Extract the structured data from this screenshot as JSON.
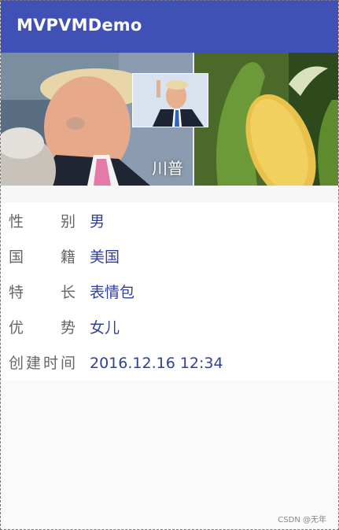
{
  "app": {
    "title": "MVPVMDemo"
  },
  "banner": {
    "name": "川普"
  },
  "info": {
    "rows": [
      {
        "label": "性  别",
        "value": "男"
      },
      {
        "label": "国  籍",
        "value": "美国"
      },
      {
        "label": "特  长",
        "value": "表情包"
      },
      {
        "label": "优  势",
        "value": "女儿"
      },
      {
        "label": "创建时间",
        "value": "2016.12.16 12:34"
      }
    ]
  },
  "footer": {
    "brand": "CSDN @无年"
  },
  "colors": {
    "appbar": "#3f51b5",
    "value_text": "#303f9f",
    "label_text": "#666666"
  }
}
